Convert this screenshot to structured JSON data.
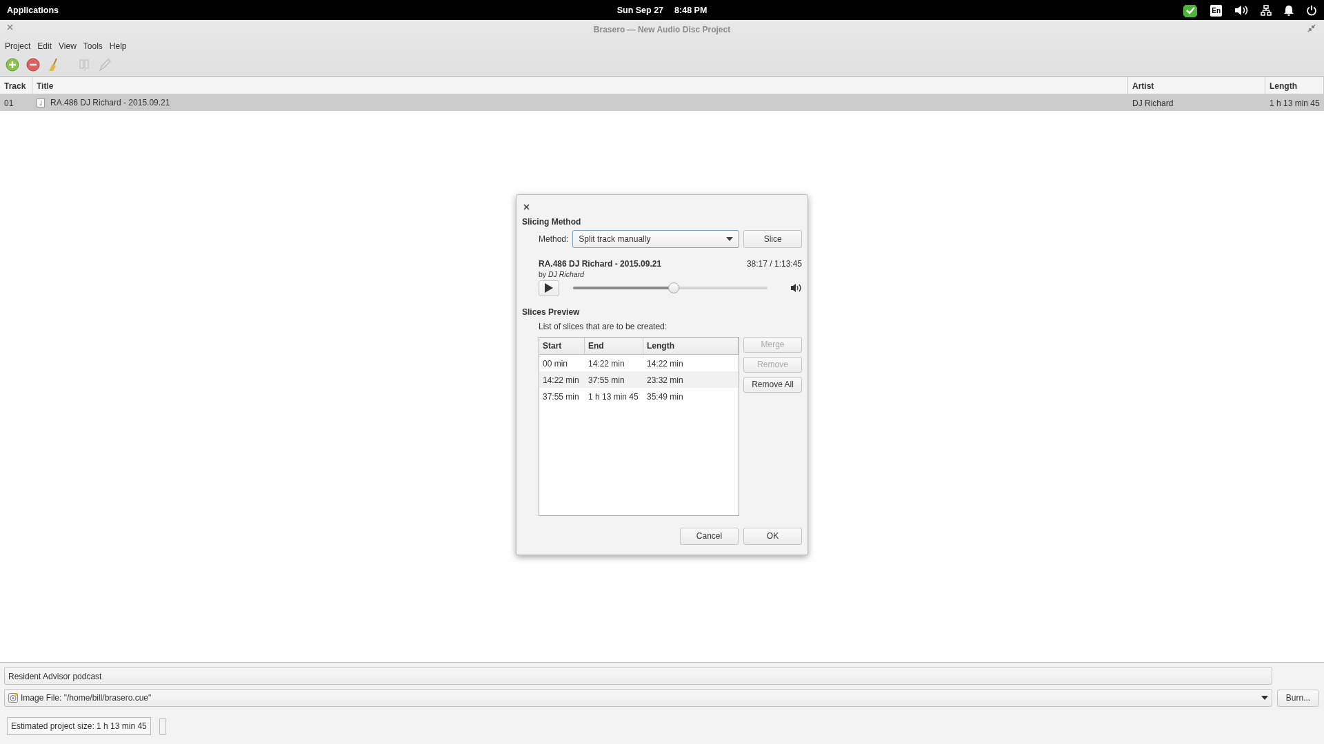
{
  "top_panel": {
    "menu": "Applications",
    "date": "Sun Sep 27",
    "time": "8:48 PM",
    "keyboard_layout": "En"
  },
  "window": {
    "title": "Brasero — New Audio Disc Project"
  },
  "menu": [
    "Project",
    "Edit",
    "View",
    "Tools",
    "Help"
  ],
  "toolbar": [
    {
      "kind": "add",
      "disabled": false
    },
    {
      "kind": "remove",
      "disabled": false
    },
    {
      "kind": "clean",
      "disabled": false
    },
    {
      "kind": "split",
      "disabled": true
    },
    {
      "kind": "edit",
      "disabled": true
    }
  ],
  "tracks": {
    "columns": [
      "Track",
      "Title",
      "Artist",
      "Length"
    ],
    "rows": [
      {
        "track": "01",
        "title": "RA.486 DJ Richard - 2015.09.21",
        "artist": "DJ Richard",
        "length": "1 h 13 min 45",
        "selected": true
      }
    ]
  },
  "disc_title": "Resident Advisor podcast",
  "destination": "Image File: \"/home/bill/brasero.cue\"",
  "burn_button": "Burn...",
  "status": "Estimated project size: 1 h 13 min 45",
  "progress": {
    "level": 0
  },
  "dialog": {
    "section_method": "Slicing Method",
    "method_label": "Method:",
    "method_value": "Split track manually",
    "slice_button": "Slice",
    "track_title": "RA.486 DJ Richard - 2015.09.21",
    "by": "by",
    "artist": "DJ Richard",
    "position": "38:17 / 1:13:45",
    "level": 0.519,
    "section_preview": "Slices Preview",
    "list_label": "List of slices that are to be created:",
    "columns": [
      "Start",
      "End",
      "Length"
    ],
    "slices": [
      {
        "start": "00 min",
        "end": "14:22 min",
        "length": "14:22 min",
        "selected": false
      },
      {
        "start": "14:22 min",
        "end": "37:55 min",
        "length": "23:32 min",
        "selected": true
      },
      {
        "start": "37:55 min",
        "end": "1 h 13 min 45",
        "length": "35:49 min",
        "selected": false
      }
    ],
    "side_buttons": [
      {
        "label": "Merge",
        "disabled": true
      },
      {
        "label": "Remove",
        "disabled": true
      },
      {
        "label": "Remove All",
        "disabled": false
      }
    ],
    "buttons": [
      "Cancel",
      "OK"
    ]
  }
}
